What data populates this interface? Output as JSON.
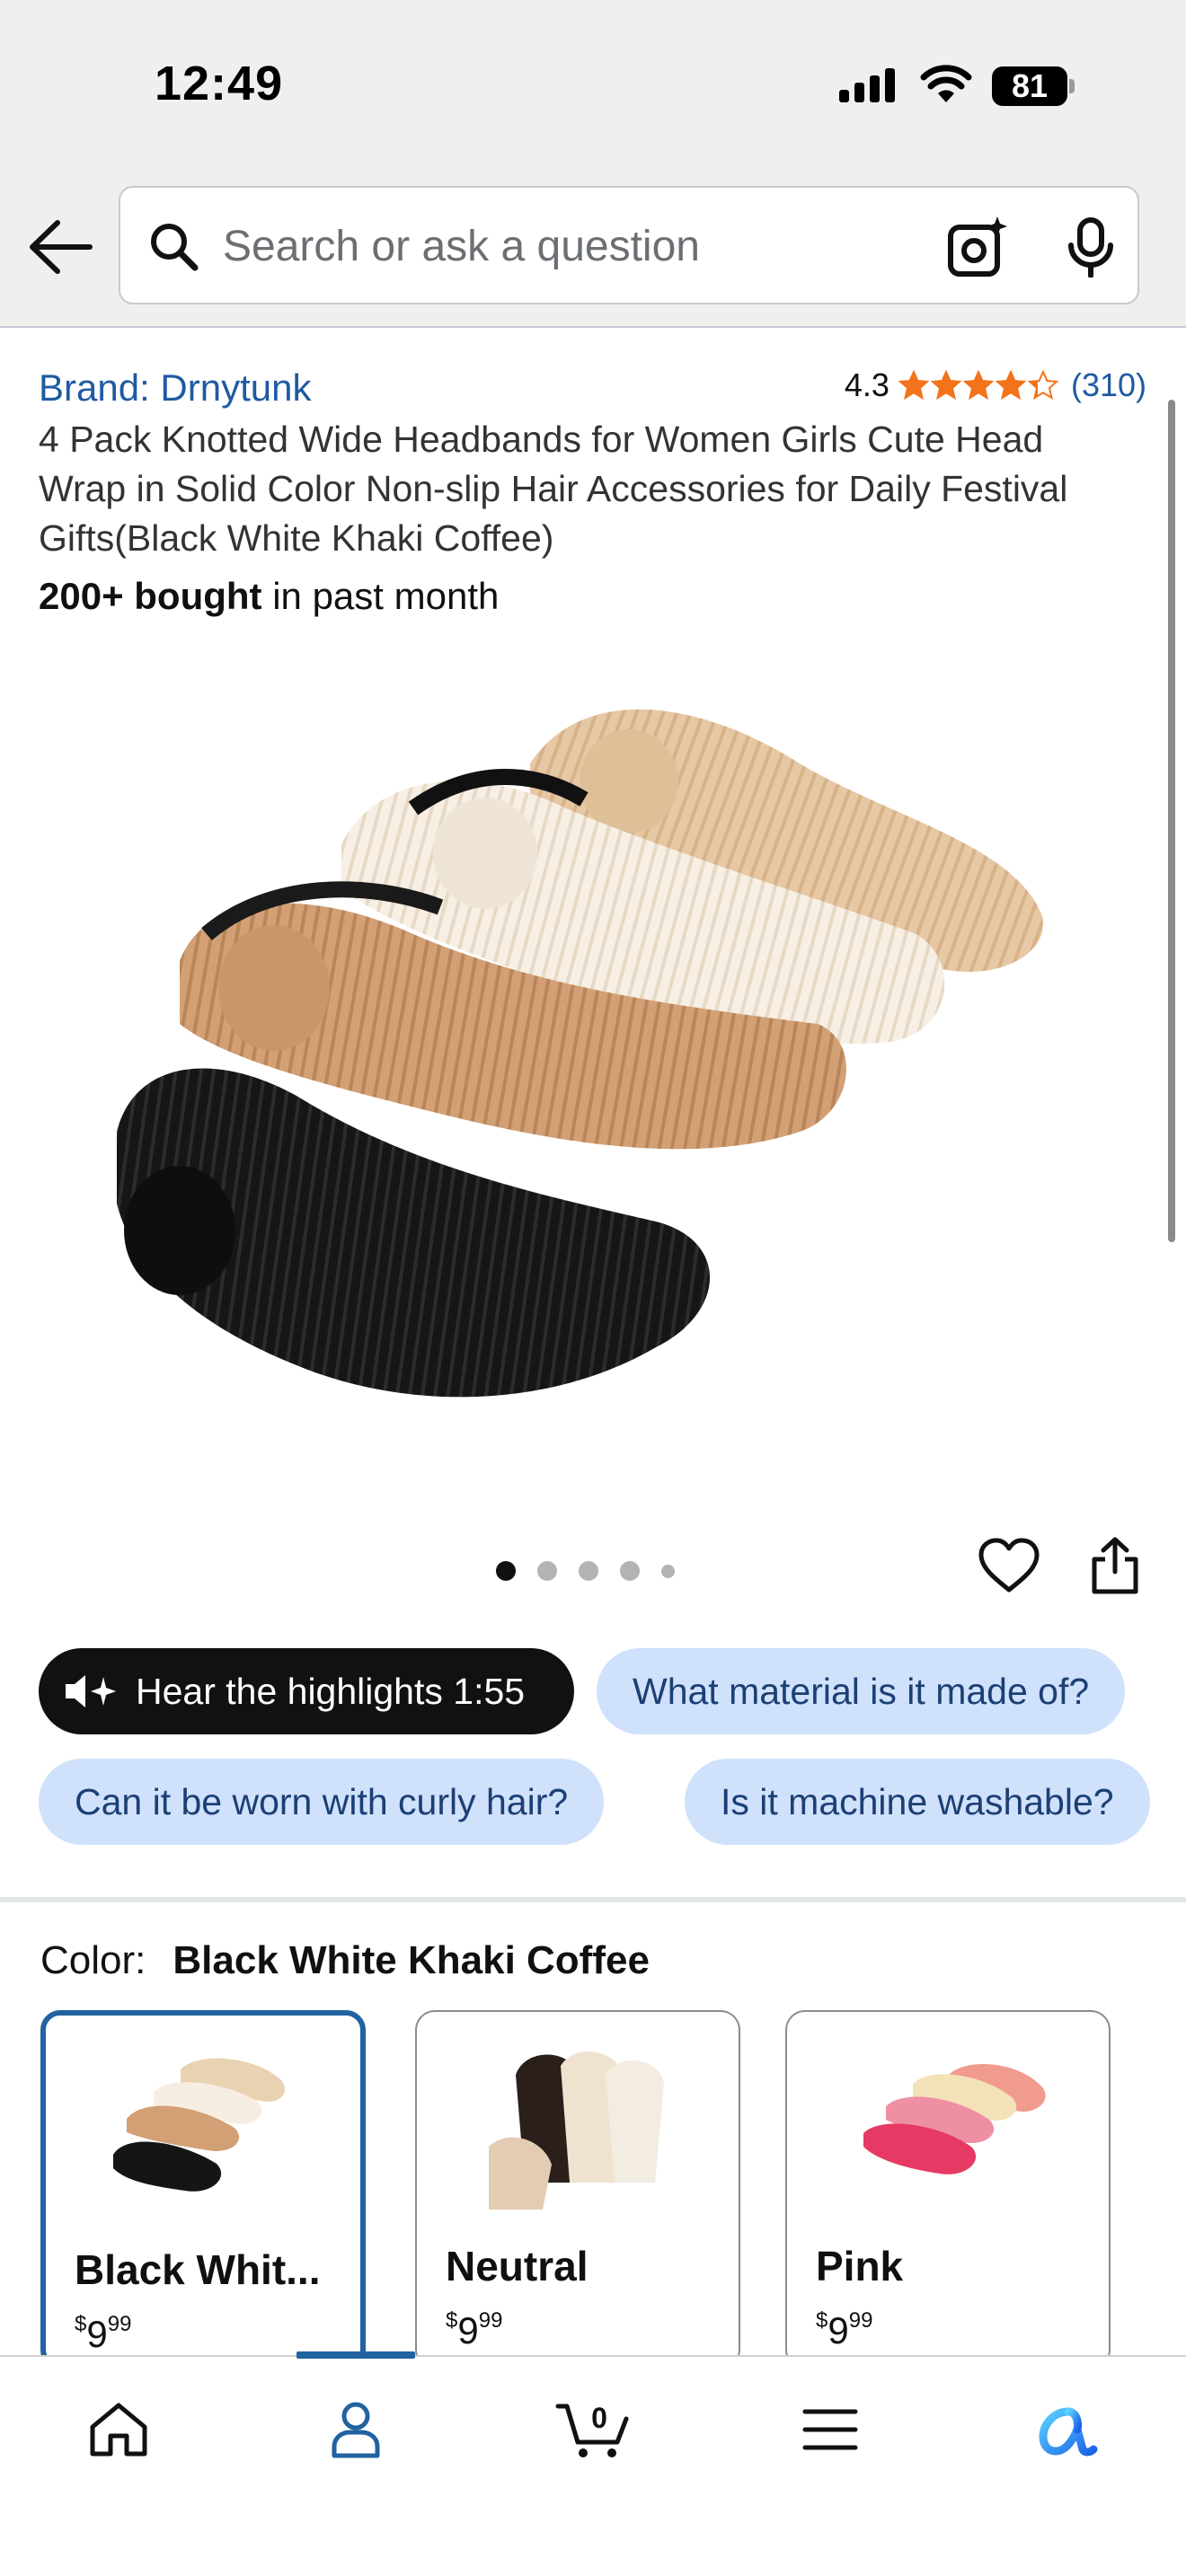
{
  "status_bar": {
    "time": "12:49",
    "battery": "81"
  },
  "search": {
    "placeholder": "Search or ask a question"
  },
  "product": {
    "brand": "Brand: Drnytunk",
    "rating": "4.3",
    "rating_stars": 4.3,
    "review_count": "(310)",
    "title": "4 Pack Knotted Wide Headbands for Women Girls Cute Head Wrap in Solid Color Non-slip Hair Accessories for Daily Festival Gifts(Black White Khaki Coffee)",
    "bought_bold": "200+ bought",
    "bought_rest": " in past month"
  },
  "carousel": {
    "image_count": 5,
    "active_index": 0
  },
  "chips": {
    "hear": "Hear the highlights 1:55",
    "material": "What material is it made of?",
    "curly": "Can it be worn with curly hair?",
    "washable": "Is it machine washable?"
  },
  "color": {
    "label": "Color:",
    "selected": "Black White Khaki Coffee",
    "options": [
      {
        "name": "Black Whit...",
        "price_currency": "$",
        "price_whole": "9",
        "price_fraction": "99"
      },
      {
        "name": "Neutral",
        "price_currency": "$",
        "price_whole": "9",
        "price_fraction": "99"
      },
      {
        "name": "Pink",
        "price_currency": "$",
        "price_whole": "9",
        "price_fraction": "99"
      }
    ]
  },
  "tabbar": {
    "cart_count": "0",
    "active_tab": "profile"
  },
  "colors": {
    "link": "#1f5aa3",
    "star": "#f3731b",
    "chip_blue": "#cfe1fb",
    "selected_border": "#2162a1"
  }
}
